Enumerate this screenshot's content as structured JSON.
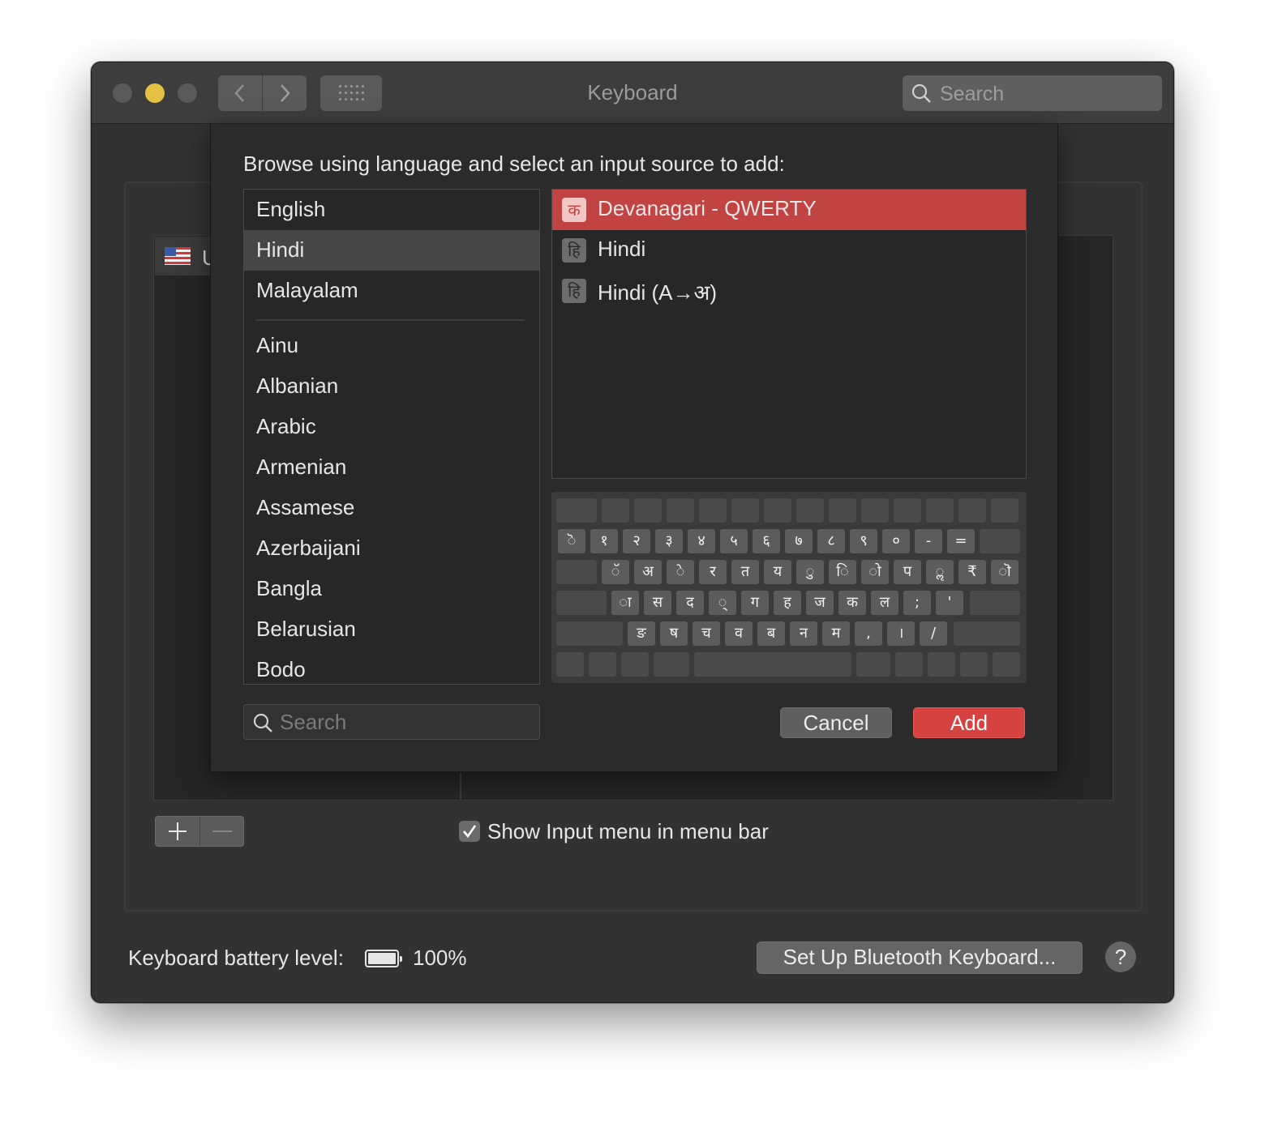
{
  "window": {
    "title": "Keyboard",
    "search_placeholder": "Search"
  },
  "background": {
    "input_row_partial": "U",
    "show_input_menu_label": "Show Input menu in menu bar",
    "show_input_menu_checked": true,
    "battery_label": "Keyboard battery level:",
    "battery_percent": "100%",
    "battery_level": 1.0,
    "bluetooth_button": "Set Up Bluetooth Keyboard...",
    "help_label": "?"
  },
  "sheet": {
    "title": "Browse using language and select an input source to add:",
    "languages": [
      "English",
      "Hindi",
      "Malayalam",
      "Ainu",
      "Albanian",
      "Arabic",
      "Armenian",
      "Assamese",
      "Azerbaijani",
      "Bangla",
      "Belarusian",
      "Bodo"
    ],
    "selected_language": "Hindi",
    "sources": [
      {
        "icon_glyph": "क",
        "label": "Devanagari - QWERTY"
      },
      {
        "icon_glyph": "हि",
        "label": "Hindi"
      },
      {
        "icon_glyph": "हि",
        "label": "Hindi (A→अ)"
      }
    ],
    "selected_source": "Devanagari - QWERTY",
    "search_placeholder": "Search",
    "cancel_label": "Cancel",
    "add_label": "Add",
    "keyboard_rows": [
      [
        "ॆ",
        "१",
        "२",
        "३",
        "४",
        "५",
        "६",
        "७",
        "८",
        "९",
        "०",
        "-",
        "="
      ],
      [
        "ॅ",
        "अ",
        "े",
        "र",
        "त",
        "य",
        "ु",
        "ि",
        "ो",
        "प",
        "ॢ",
        "₹",
        "ॊ"
      ],
      [
        "ा",
        "स",
        "द",
        "्",
        "ग",
        "ह",
        "ज",
        "क",
        "ल",
        ";",
        "'"
      ],
      [
        "ङ",
        "ष",
        "च",
        "व",
        "ब",
        "न",
        "म",
        ",",
        "।",
        "/"
      ]
    ]
  },
  "colors": {
    "accent": "#d6423f",
    "selection": "#c14342",
    "window_bg": "#323232",
    "minimize_light": "#e4c043"
  }
}
